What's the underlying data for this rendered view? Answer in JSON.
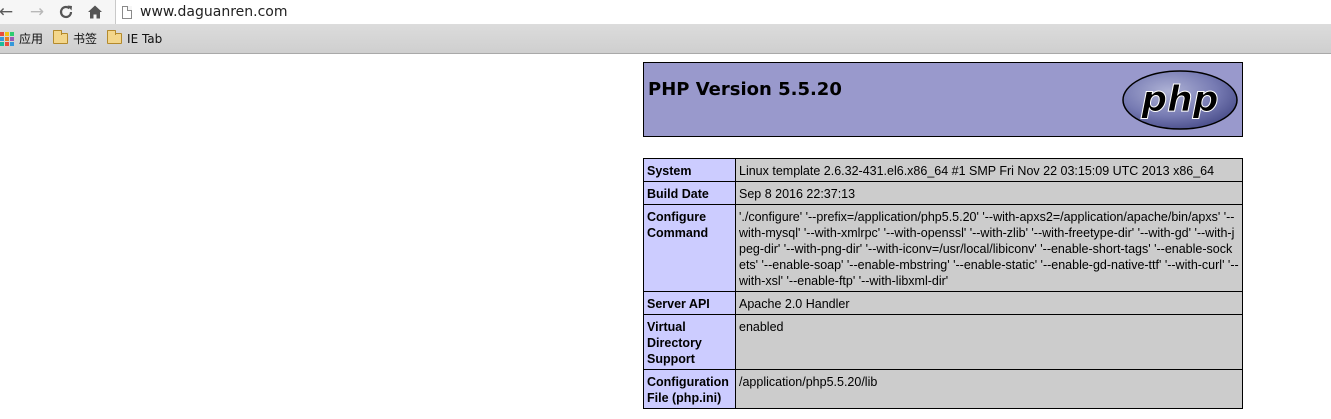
{
  "browser": {
    "url": "www.daguanren.com",
    "nav": {
      "back": "back-icon",
      "forward": "forward-icon",
      "reload": "reload-icon",
      "home": "home-icon"
    },
    "bookmarks": [
      {
        "label": "应用",
        "icon": "apps-icon"
      },
      {
        "label": "书签",
        "icon": "folder-icon"
      },
      {
        "label": "IE Tab",
        "icon": "folder-icon"
      }
    ]
  },
  "phpinfo": {
    "title": "PHP Version 5.5.20",
    "logo_text": "php",
    "colors": {
      "header_bg": "#9999cc",
      "key_bg": "#ccccff",
      "value_bg": "#cccccc"
    },
    "rows": [
      {
        "key": "System",
        "value": "Linux template 2.6.32-431.el6.x86_64 #1 SMP Fri Nov 22 03:15:09 UTC 2013 x86_64"
      },
      {
        "key": "Build Date",
        "value": "Sep 8 2016 22:37:13"
      },
      {
        "key": "Configure Command",
        "value": "'./configure' '--prefix=/application/php5.5.20' '--with-apxs2=/application/apache/bin/apxs' '--with-mysql' '--with-xmlrpc' '--with-openssl' '--with-zlib' '--with-freetype-dir' '--with-gd' '--with-jpeg-dir' '--with-png-dir' '--with-iconv=/usr/local/libiconv' '--enable-short-tags' '--enable-sockets' '--enable-soap' '--enable-mbstring' '--enable-static' '--enable-gd-native-ttf' '--with-curl' '--with-xsl' '--enable-ftp' '--with-libxml-dir'"
      },
      {
        "key": "Server API",
        "value": "Apache 2.0 Handler"
      },
      {
        "key": "Virtual Directory Support",
        "value": "enabled"
      },
      {
        "key": "Configuration File (php.ini)",
        "value": "/application/php5.5.20/lib"
      }
    ]
  }
}
